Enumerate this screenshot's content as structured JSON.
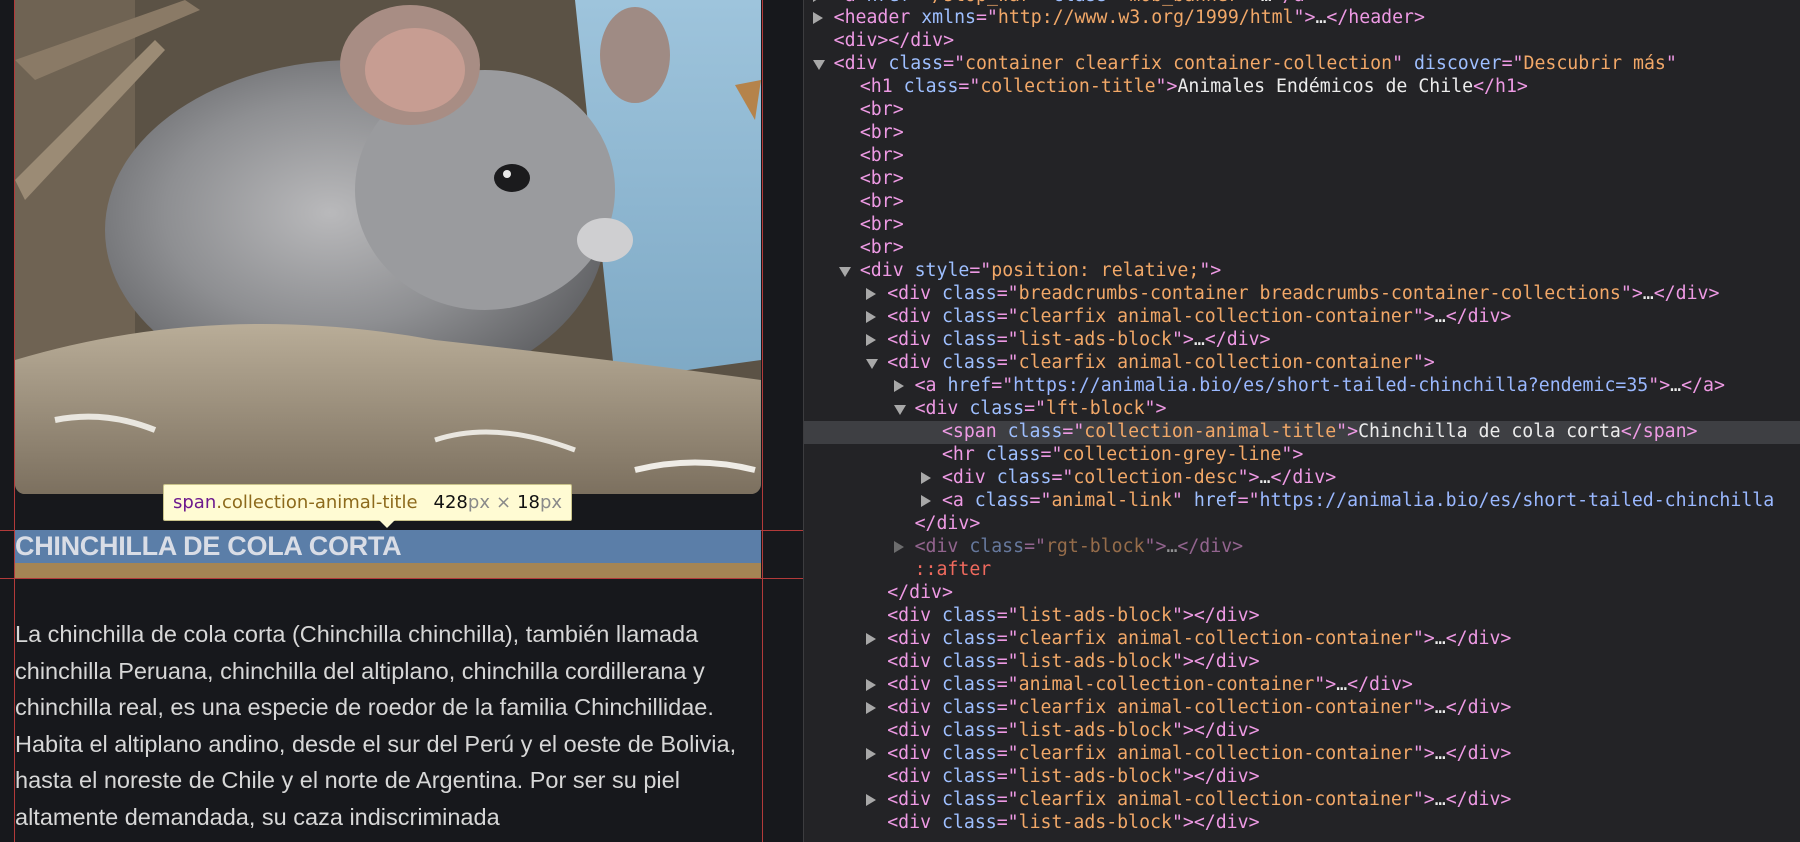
{
  "preview": {
    "photo_alt": "Chinchilla de cola corta",
    "tooltip": {
      "tag": "span",
      "cls": ".collection-animal-title",
      "width": "428",
      "height": "18",
      "unit": "px",
      "times": "×"
    },
    "animal_title": "CHINCHILLA DE COLA CORTA",
    "description": "La chinchilla de cola corta (Chinchilla chinchilla), también llamada chinchilla Peruana, chinchilla del altiplano, chinchilla cordillerana y chinchilla real, es una especie de roedor de la familia Chinchillidae. Habita el altiplano andino, desde el sur del Perú y el oeste de Bolivia, hasta el noreste de Chile y el norte de Argentina. Por ser su piel altamente demandada, su caza indiscriminada"
  },
  "dom_tree": [
    {
      "arrow": "closed",
      "parts": [
        [
          "t",
          "<a "
        ],
        [
          "a",
          "href"
        ],
        [
          "t",
          "=\""
        ],
        [
          "v",
          "/stop_war"
        ],
        [
          "t",
          "\" "
        ],
        [
          "a",
          "class"
        ],
        [
          "t",
          "=\""
        ],
        [
          "v",
          "mob_banner"
        ],
        [
          "t",
          "\">"
        ],
        [
          "txt",
          "…"
        ],
        [
          "t",
          "</a>"
        ]
      ]
    },
    {
      "arrow": "closed",
      "parts": [
        [
          "t",
          "<header "
        ],
        [
          "a",
          "xmlns"
        ],
        [
          "t",
          "=\""
        ],
        [
          "v",
          "http://www.w3.org/1999/html"
        ],
        [
          "t",
          "\">"
        ],
        [
          "txt",
          "…"
        ],
        [
          "t",
          "</header>"
        ]
      ]
    },
    {
      "arrow": "none",
      "parts": [
        [
          "t",
          "<div></div>"
        ]
      ]
    },
    {
      "arrow": "open",
      "parts": [
        [
          "t",
          "<div "
        ],
        [
          "a",
          "class"
        ],
        [
          "t",
          "=\""
        ],
        [
          "v",
          "container clearfix container-collection"
        ],
        [
          "t",
          "\" "
        ],
        [
          "a",
          "discover"
        ],
        [
          "t",
          "=\""
        ],
        [
          "v",
          "Descubrir más"
        ],
        [
          "t",
          "\""
        ]
      ]
    },
    {
      "arrow": "none",
      "parts": [
        [
          "t",
          "<h1 "
        ],
        [
          "a",
          "class"
        ],
        [
          "t",
          "=\""
        ],
        [
          "v",
          "collection-title"
        ],
        [
          "t",
          "\">"
        ],
        [
          "txt",
          "Animales Endémicos de Chile"
        ],
        [
          "t",
          "</h1>"
        ]
      ]
    },
    {
      "arrow": "none",
      "parts": [
        [
          "t",
          "<br>"
        ]
      ]
    },
    {
      "arrow": "none",
      "parts": [
        [
          "t",
          "<br>"
        ]
      ]
    },
    {
      "arrow": "none",
      "parts": [
        [
          "t",
          "<br>"
        ]
      ]
    },
    {
      "arrow": "none",
      "parts": [
        [
          "t",
          "<br>"
        ]
      ]
    },
    {
      "arrow": "none",
      "parts": [
        [
          "t",
          "<br>"
        ]
      ]
    },
    {
      "arrow": "none",
      "parts": [
        [
          "t",
          "<br>"
        ]
      ]
    },
    {
      "arrow": "none",
      "parts": [
        [
          "t",
          "<br>"
        ]
      ]
    },
    {
      "arrow": "open",
      "parts": [
        [
          "t",
          "<div "
        ],
        [
          "a",
          "style"
        ],
        [
          "t",
          "=\""
        ],
        [
          "v",
          "position: relative;"
        ],
        [
          "t",
          "\">"
        ]
      ]
    },
    {
      "arrow": "closed",
      "parts": [
        [
          "t",
          "<div "
        ],
        [
          "a",
          "class"
        ],
        [
          "t",
          "=\""
        ],
        [
          "v",
          "breadcrumbs-container breadcrumbs-container-collections"
        ],
        [
          "t",
          "\">"
        ],
        [
          "txt",
          "…"
        ],
        [
          "t",
          "</div>"
        ]
      ]
    },
    {
      "arrow": "closed",
      "parts": [
        [
          "t",
          "<div "
        ],
        [
          "a",
          "class"
        ],
        [
          "t",
          "=\""
        ],
        [
          "v",
          "clearfix animal-collection-container"
        ],
        [
          "t",
          "\">"
        ],
        [
          "txt",
          "…"
        ],
        [
          "t",
          "</div>"
        ]
      ]
    },
    {
      "arrow": "closed",
      "parts": [
        [
          "t",
          "<div "
        ],
        [
          "a",
          "class"
        ],
        [
          "t",
          "=\""
        ],
        [
          "v",
          "list-ads-block"
        ],
        [
          "t",
          "\">"
        ],
        [
          "txt",
          "…"
        ],
        [
          "t",
          "</div>"
        ]
      ]
    },
    {
      "arrow": "open",
      "parts": [
        [
          "t",
          "<div "
        ],
        [
          "a",
          "class"
        ],
        [
          "t",
          "=\""
        ],
        [
          "v",
          "clearfix animal-collection-container"
        ],
        [
          "t",
          "\">"
        ]
      ]
    },
    {
      "arrow": "closed",
      "parts": [
        [
          "t",
          "<a "
        ],
        [
          "a",
          "href"
        ],
        [
          "t",
          "=\""
        ],
        [
          "u",
          "https://animalia.bio/es/short-tailed-chinchilla?endemic=35"
        ],
        [
          "t",
          "\">"
        ],
        [
          "txt",
          "…"
        ],
        [
          "t",
          "</a>"
        ]
      ]
    },
    {
      "arrow": "open",
      "parts": [
        [
          "t",
          "<div "
        ],
        [
          "a",
          "class"
        ],
        [
          "t",
          "=\""
        ],
        [
          "v",
          "lft-block"
        ],
        [
          "t",
          "\">"
        ]
      ]
    },
    {
      "arrow": "none",
      "selected": true,
      "parts": [
        [
          "t",
          "<span "
        ],
        [
          "a",
          "class"
        ],
        [
          "t",
          "=\""
        ],
        [
          "v",
          "collection-animal-title"
        ],
        [
          "t",
          "\">"
        ],
        [
          "txt",
          "Chinchilla de cola corta"
        ],
        [
          "t",
          "</span>"
        ]
      ]
    },
    {
      "arrow": "none",
      "parts": [
        [
          "t",
          "<hr "
        ],
        [
          "a",
          "class"
        ],
        [
          "t",
          "=\""
        ],
        [
          "v",
          "collection-grey-line"
        ],
        [
          "t",
          "\">"
        ]
      ]
    },
    {
      "arrow": "closed",
      "parts": [
        [
          "t",
          "<div "
        ],
        [
          "a",
          "class"
        ],
        [
          "t",
          "=\""
        ],
        [
          "v",
          "collection-desc"
        ],
        [
          "t",
          "\">"
        ],
        [
          "txt",
          "…"
        ],
        [
          "t",
          "</div>"
        ]
      ]
    },
    {
      "arrow": "closed",
      "parts": [
        [
          "t",
          "<a "
        ],
        [
          "a",
          "class"
        ],
        [
          "t",
          "=\""
        ],
        [
          "v",
          "animal-link"
        ],
        [
          "t",
          "\" "
        ],
        [
          "a",
          "href"
        ],
        [
          "t",
          "=\""
        ],
        [
          "u",
          "https://animalia.bio/es/short-tailed-chinchilla"
        ]
      ]
    },
    {
      "arrow": "none",
      "parts": [
        [
          "t",
          "</div>"
        ]
      ]
    },
    {
      "arrow": "closed",
      "dimmed": true,
      "parts": [
        [
          "t",
          "<div "
        ],
        [
          "a",
          "class"
        ],
        [
          "t",
          "=\""
        ],
        [
          "v",
          "rgt-block"
        ],
        [
          "t",
          "\">"
        ],
        [
          "txt",
          "…"
        ],
        [
          "t",
          "</div>"
        ]
      ]
    },
    {
      "arrow": "none",
      "parts": [
        [
          "ps",
          "::after"
        ]
      ]
    },
    {
      "arrow": "none",
      "parts": [
        [
          "t",
          "</div>"
        ]
      ]
    },
    {
      "arrow": "none",
      "parts": [
        [
          "t",
          "<div "
        ],
        [
          "a",
          "class"
        ],
        [
          "t",
          "=\""
        ],
        [
          "v",
          "list-ads-block"
        ],
        [
          "t",
          "\"></div>"
        ]
      ]
    },
    {
      "arrow": "closed",
      "parts": [
        [
          "t",
          "<div "
        ],
        [
          "a",
          "class"
        ],
        [
          "t",
          "=\""
        ],
        [
          "v",
          "clearfix animal-collection-container"
        ],
        [
          "t",
          "\">"
        ],
        [
          "txt",
          "…"
        ],
        [
          "t",
          "</div>"
        ]
      ]
    },
    {
      "arrow": "none",
      "parts": [
        [
          "t",
          "<div "
        ],
        [
          "a",
          "class"
        ],
        [
          "t",
          "=\""
        ],
        [
          "v",
          "list-ads-block"
        ],
        [
          "t",
          "\"></div>"
        ]
      ]
    },
    {
      "arrow": "closed",
      "parts": [
        [
          "t",
          "<div "
        ],
        [
          "a",
          "class"
        ],
        [
          "t",
          "=\""
        ],
        [
          "v",
          "animal-collection-container"
        ],
        [
          "t",
          "\">"
        ],
        [
          "txt",
          "…"
        ],
        [
          "t",
          "</div>"
        ]
      ]
    },
    {
      "arrow": "closed",
      "parts": [
        [
          "t",
          "<div "
        ],
        [
          "a",
          "class"
        ],
        [
          "t",
          "=\""
        ],
        [
          "v",
          "clearfix animal-collection-container"
        ],
        [
          "t",
          "\">"
        ],
        [
          "txt",
          "…"
        ],
        [
          "t",
          "</div>"
        ]
      ]
    },
    {
      "arrow": "none",
      "parts": [
        [
          "t",
          "<div "
        ],
        [
          "a",
          "class"
        ],
        [
          "t",
          "=\""
        ],
        [
          "v",
          "list-ads-block"
        ],
        [
          "t",
          "\"></div>"
        ]
      ]
    },
    {
      "arrow": "closed",
      "parts": [
        [
          "t",
          "<div "
        ],
        [
          "a",
          "class"
        ],
        [
          "t",
          "=\""
        ],
        [
          "v",
          "clearfix animal-collection-container"
        ],
        [
          "t",
          "\">"
        ],
        [
          "txt",
          "…"
        ],
        [
          "t",
          "</div>"
        ]
      ]
    },
    {
      "arrow": "none",
      "parts": [
        [
          "t",
          "<div "
        ],
        [
          "a",
          "class"
        ],
        [
          "t",
          "=\""
        ],
        [
          "v",
          "list-ads-block"
        ],
        [
          "t",
          "\"></div>"
        ]
      ]
    },
    {
      "arrow": "closed",
      "parts": [
        [
          "t",
          "<div "
        ],
        [
          "a",
          "class"
        ],
        [
          "t",
          "=\""
        ],
        [
          "v",
          "clearfix animal-collection-container"
        ],
        [
          "t",
          "\">"
        ],
        [
          "txt",
          "…"
        ],
        [
          "t",
          "</div>"
        ]
      ]
    },
    {
      "arrow": "none",
      "parts": [
        [
          "t",
          "<div "
        ],
        [
          "a",
          "class"
        ],
        [
          "t",
          "=\""
        ],
        [
          "v",
          "list-ads-block"
        ],
        [
          "t",
          "\"></div>"
        ]
      ]
    }
  ]
}
